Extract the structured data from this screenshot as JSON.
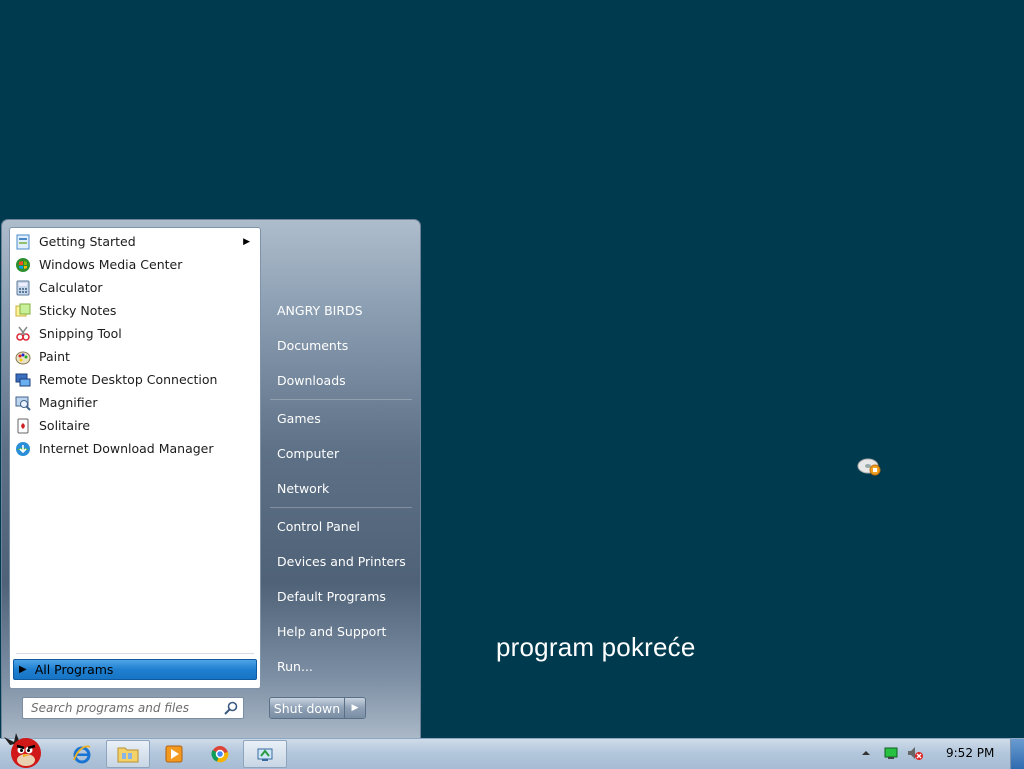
{
  "desktop": {
    "caption": "program pokreće",
    "icon": "cd-disc-icon"
  },
  "start_menu": {
    "programs": [
      {
        "label": "Getting Started",
        "icon": "getting-started-icon",
        "has_submenu": true
      },
      {
        "label": "Windows Media Center",
        "icon": "media-center-icon"
      },
      {
        "label": "Calculator",
        "icon": "calculator-icon"
      },
      {
        "label": "Sticky Notes",
        "icon": "sticky-notes-icon"
      },
      {
        "label": "Snipping Tool",
        "icon": "snipping-tool-icon"
      },
      {
        "label": "Paint",
        "icon": "paint-icon"
      },
      {
        "label": "Remote Desktop Connection",
        "icon": "remote-desktop-icon"
      },
      {
        "label": "Magnifier",
        "icon": "magnifier-icon"
      },
      {
        "label": "Solitaire",
        "icon": "solitaire-icon"
      },
      {
        "label": "Internet Download Manager",
        "icon": "idm-icon"
      }
    ],
    "all_programs": "All Programs",
    "search_placeholder": "Search programs and files",
    "right_items": [
      "ANGRY BIRDS",
      "Documents",
      "Downloads",
      "Games",
      "Computer",
      "Network",
      "Control Panel",
      "Devices and Printers",
      "Default Programs",
      "Help and Support",
      "Run..."
    ],
    "shutdown_label": "Shut down"
  },
  "taskbar": {
    "pinned": [
      {
        "name": "internet-explorer",
        "icon": "internet-explorer-icon"
      },
      {
        "name": "explorer",
        "icon": "folder-icon"
      },
      {
        "name": "media-player",
        "icon": "media-player-icon"
      },
      {
        "name": "chrome",
        "icon": "chrome-icon"
      },
      {
        "name": "app",
        "icon": "network-app-icon"
      }
    ],
    "clock": "9:52 PM"
  },
  "colors": {
    "desktop_bg": "#003a4e",
    "selection": "#1f7fd0"
  }
}
